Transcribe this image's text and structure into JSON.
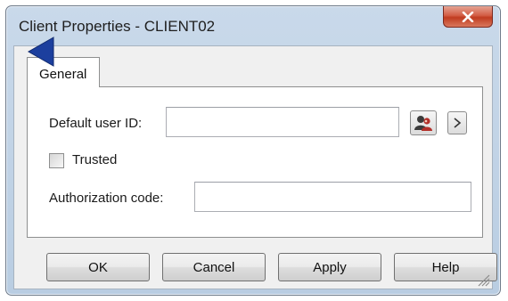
{
  "window": {
    "title": "Client Properties - CLIENT02"
  },
  "tabs": [
    {
      "label": "General",
      "selected": true
    }
  ],
  "general": {
    "default_user_id_label": "Default user ID:",
    "default_user_id_value": "",
    "trusted_label": "Trusted",
    "trusted_checked": false,
    "authorization_code_label": "Authorization code:",
    "authorization_code_value": "",
    "user_picker_icon": "users-icon",
    "expand_button_label": ">"
  },
  "buttons": {
    "ok": "OK",
    "cancel": "Cancel",
    "apply": "Apply",
    "help": "Help"
  },
  "colors": {
    "close_button": "#c9472c",
    "window_frame": "#bfd2e6",
    "dialog_face": "#f0f0f0"
  }
}
